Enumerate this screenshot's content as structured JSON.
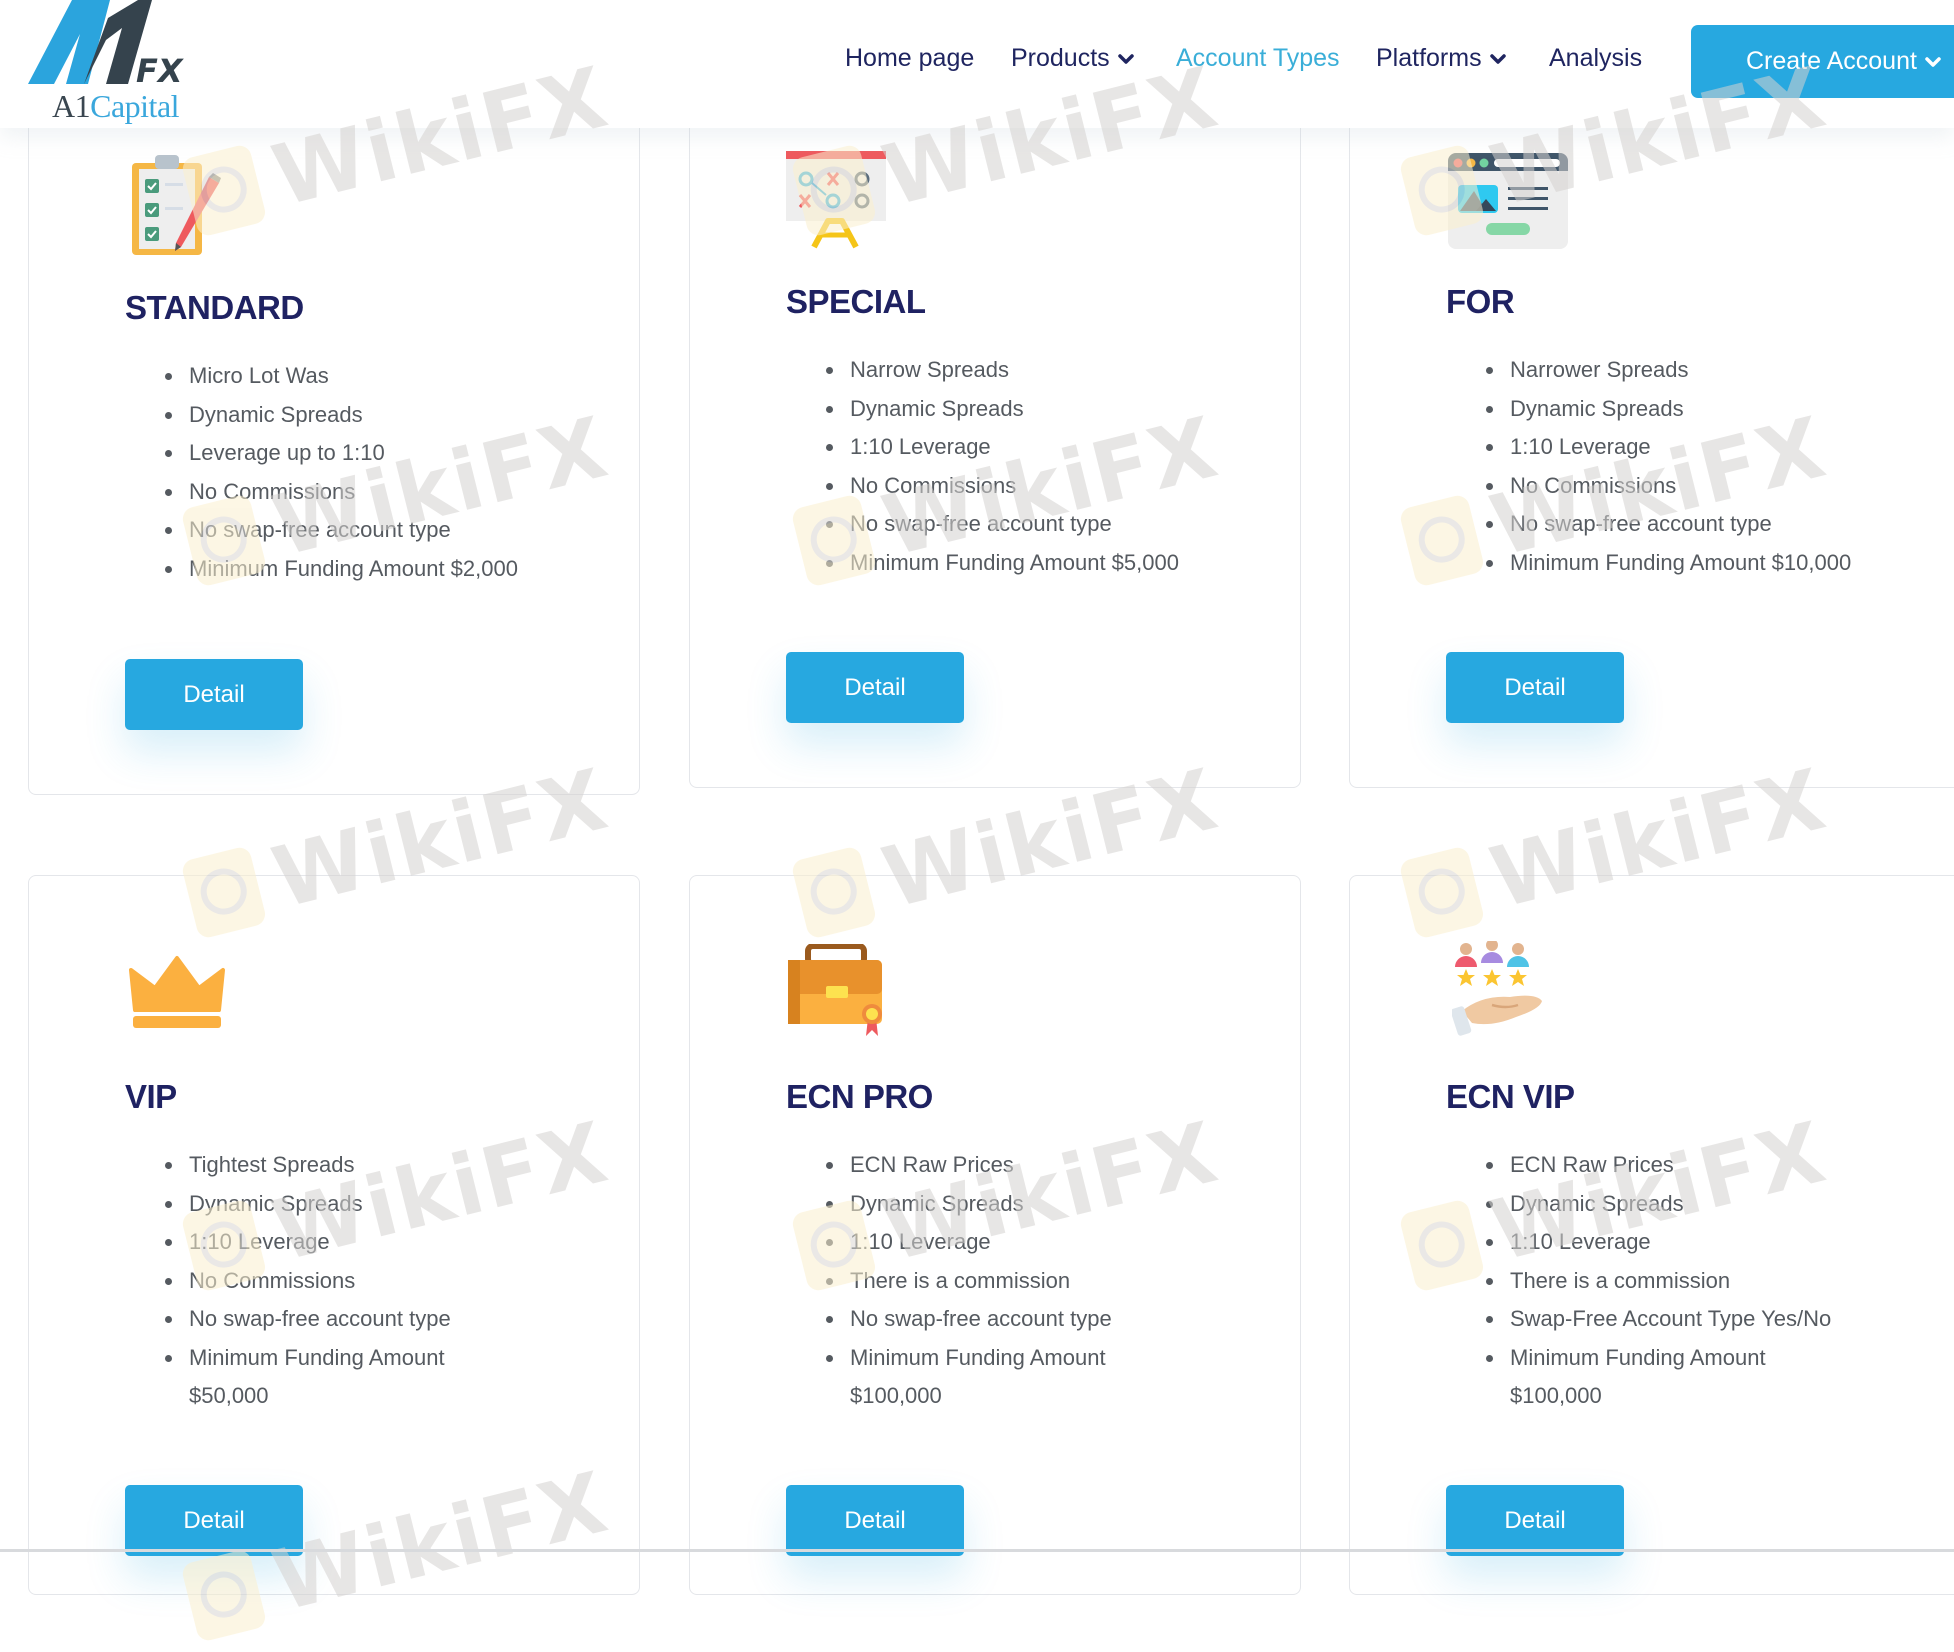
{
  "logo": {
    "mark": "A1 FX",
    "fx": "FX",
    "a1": "A1",
    "capital": "Capital"
  },
  "nav": {
    "items": [
      {
        "label": "Home page",
        "dropdown": false,
        "active": false
      },
      {
        "label": "Products",
        "dropdown": true,
        "active": false
      },
      {
        "label": "Account Types",
        "dropdown": false,
        "active": true
      },
      {
        "label": "Platforms",
        "dropdown": true,
        "active": false
      },
      {
        "label": "Analysis",
        "dropdown": false,
        "active": false
      }
    ],
    "create_account": "Create Account"
  },
  "colors": {
    "brand_blue": "#27a8e0",
    "active_nav": "#3aaed8",
    "title_navy": "#1f2262",
    "text_gray": "#555a60"
  },
  "accounts": [
    {
      "name": "STANDARD",
      "icon": "clipboard-checklist-icon",
      "features": [
        "Micro Lot Was",
        "Dynamic Spreads",
        "Leverage up to 1:10",
        "No Commissions",
        "No swap-free account type",
        "Minimum Funding Amount $2,000"
      ],
      "button": "Detail"
    },
    {
      "name": "SPECIAL",
      "icon": "strategy-board-icon",
      "features": [
        "Narrow Spreads",
        "Dynamic Spreads",
        "1:10 Leverage",
        "No Commissions",
        "No swap-free account type",
        "Minimum Funding Amount $5,000"
      ],
      "button": "Detail"
    },
    {
      "name": "FOR",
      "icon": "browser-window-icon",
      "features": [
        "Narrower Spreads",
        "Dynamic Spreads",
        "1:10 Leverage",
        "No Commissions",
        "No swap-free account type",
        "Minimum Funding Amount $10,000"
      ],
      "button": "Detail"
    },
    {
      "name": "VIP",
      "icon": "crown-icon",
      "features": [
        "Tightest Spreads",
        "Dynamic Spreads",
        "1:10 Leverage",
        "No Commissions",
        "No swap-free account type",
        "Minimum Funding Amount $50,000"
      ],
      "button": "Detail"
    },
    {
      "name": "ECN PRO",
      "icon": "briefcase-award-icon",
      "features": [
        "ECN Raw Prices",
        "Dynamic Spreads",
        "1:10 Leverage",
        "There is a commission",
        "No swap-free account type",
        "Minimum Funding Amount $100,000"
      ],
      "button": "Detail"
    },
    {
      "name": "ECN VIP",
      "icon": "hand-rated-users-icon",
      "features": [
        "ECN Raw Prices",
        "Dynamic Spreads",
        "1:10 Leverage",
        "There is a commission",
        "Swap-Free Account Type Yes/No",
        "Minimum Funding Amount $100,000"
      ],
      "button": "Detail"
    }
  ],
  "watermark": "WikiFX"
}
